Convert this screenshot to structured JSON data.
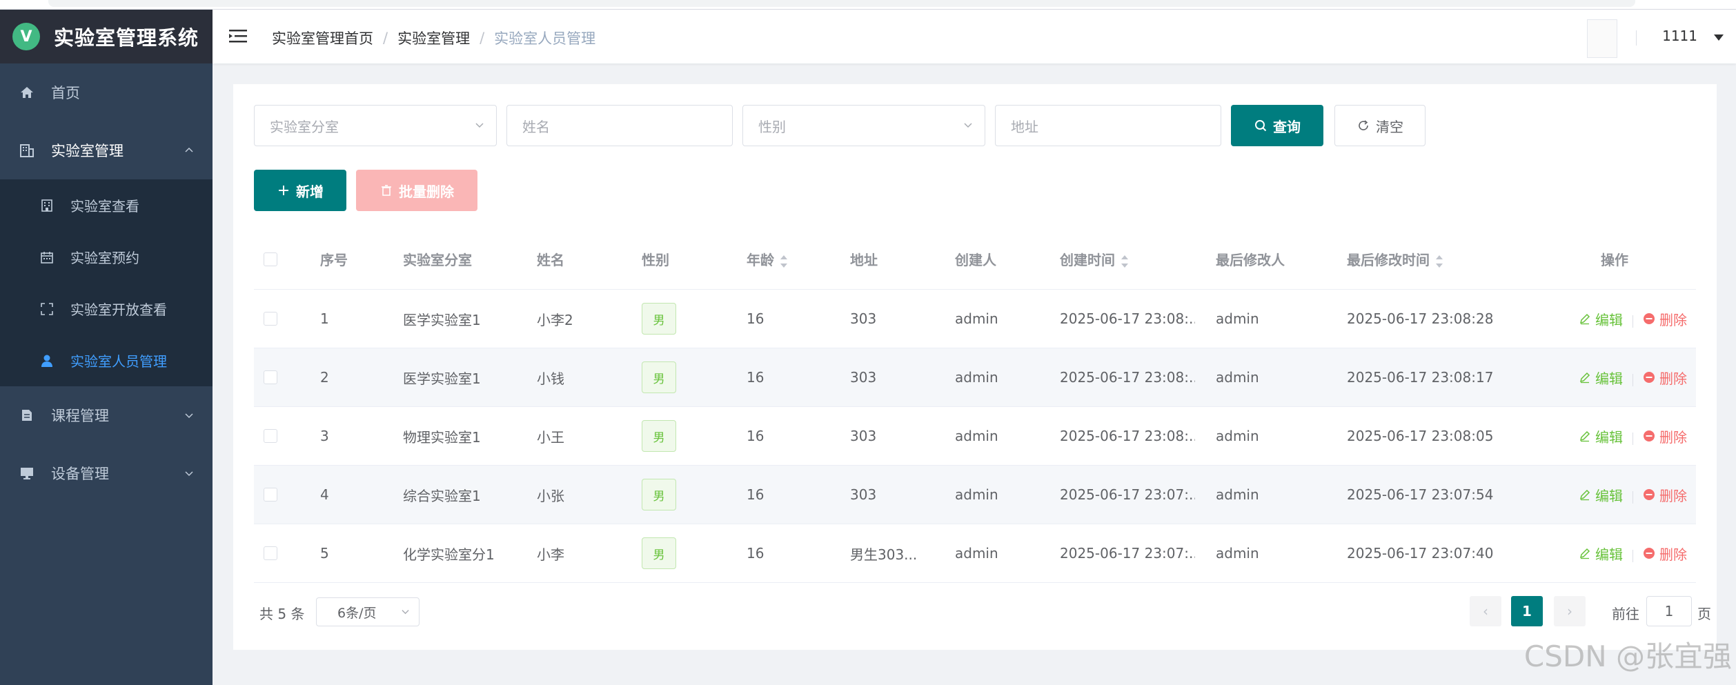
{
  "app": {
    "title": "实验室管理系统",
    "logo_letter": "V"
  },
  "sidebar": {
    "items": [
      {
        "label": "首页",
        "icon": "home-icon"
      },
      {
        "label": "实验室管理",
        "icon": "building-icon",
        "expanded": true,
        "children": [
          {
            "label": "实验室查看",
            "icon": "office-building-icon"
          },
          {
            "label": "实验室预约",
            "icon": "calendar-icon"
          },
          {
            "label": "实验室开放查看",
            "icon": "fullscreen-icon"
          },
          {
            "label": "实验室人员管理",
            "icon": "user-icon",
            "active": true
          }
        ]
      },
      {
        "label": "课程管理",
        "icon": "document-icon"
      },
      {
        "label": "设备管理",
        "icon": "monitor-icon"
      }
    ]
  },
  "header": {
    "breadcrumb": [
      "实验室管理首页",
      "实验室管理",
      "实验室人员管理"
    ],
    "username": "1111"
  },
  "filters": {
    "lab_branch_placeholder": "实验室分室",
    "name_placeholder": "姓名",
    "gender_placeholder": "性别",
    "address_placeholder": "地址",
    "query_label": "查询",
    "clear_label": "清空"
  },
  "toolbar": {
    "add_label": "新增",
    "batch_delete_label": "批量删除"
  },
  "table": {
    "columns": [
      "序号",
      "实验室分室",
      "姓名",
      "性别",
      "年龄",
      "地址",
      "创建人",
      "创建时间",
      "最后修改人",
      "最后修改时间",
      "操作"
    ],
    "edit_label": "编辑",
    "delete_label": "删除",
    "rows": [
      {
        "index": "1",
        "lab": "医学实验室1",
        "name": "小李2",
        "gender": "男",
        "age": "16",
        "address": "303",
        "creator": "admin",
        "created": "2025-06-17 23:08:...",
        "modifier": "admin",
        "modified": "2025-06-17 23:08:28"
      },
      {
        "index": "2",
        "lab": "医学实验室1",
        "name": "小钱",
        "gender": "男",
        "age": "16",
        "address": "303",
        "creator": "admin",
        "created": "2025-06-17 23:08:...",
        "modifier": "admin",
        "modified": "2025-06-17 23:08:17"
      },
      {
        "index": "3",
        "lab": "物理实验室1",
        "name": "小王",
        "gender": "男",
        "age": "16",
        "address": "303",
        "creator": "admin",
        "created": "2025-06-17 23:08:...",
        "modifier": "admin",
        "modified": "2025-06-17 23:08:05"
      },
      {
        "index": "4",
        "lab": "综合实验室1",
        "name": "小张",
        "gender": "男",
        "age": "16",
        "address": "303",
        "creator": "admin",
        "created": "2025-06-17 23:07:...",
        "modifier": "admin",
        "modified": "2025-06-17 23:07:54"
      },
      {
        "index": "5",
        "lab": "化学实验室分1",
        "name": "小李",
        "gender": "男",
        "age": "16",
        "address": "男生303...",
        "creator": "admin",
        "created": "2025-06-17 23:07:...",
        "modifier": "admin",
        "modified": "2025-06-17 23:07:40"
      }
    ]
  },
  "pagination": {
    "total_text": "共 5 条",
    "page_size": "6条/页",
    "current_page": "1",
    "prev_symbol": "‹",
    "next_symbol": "›",
    "goto_prefix": "前往",
    "goto_value": "1",
    "goto_suffix": "页"
  },
  "watermark": "CSDN @张宜强",
  "colors": {
    "primary": "#007d7f",
    "sidebar_bg": "#304156",
    "active_menu": "#409eff",
    "edit": "#67c23a",
    "delete": "#f56c6c"
  }
}
